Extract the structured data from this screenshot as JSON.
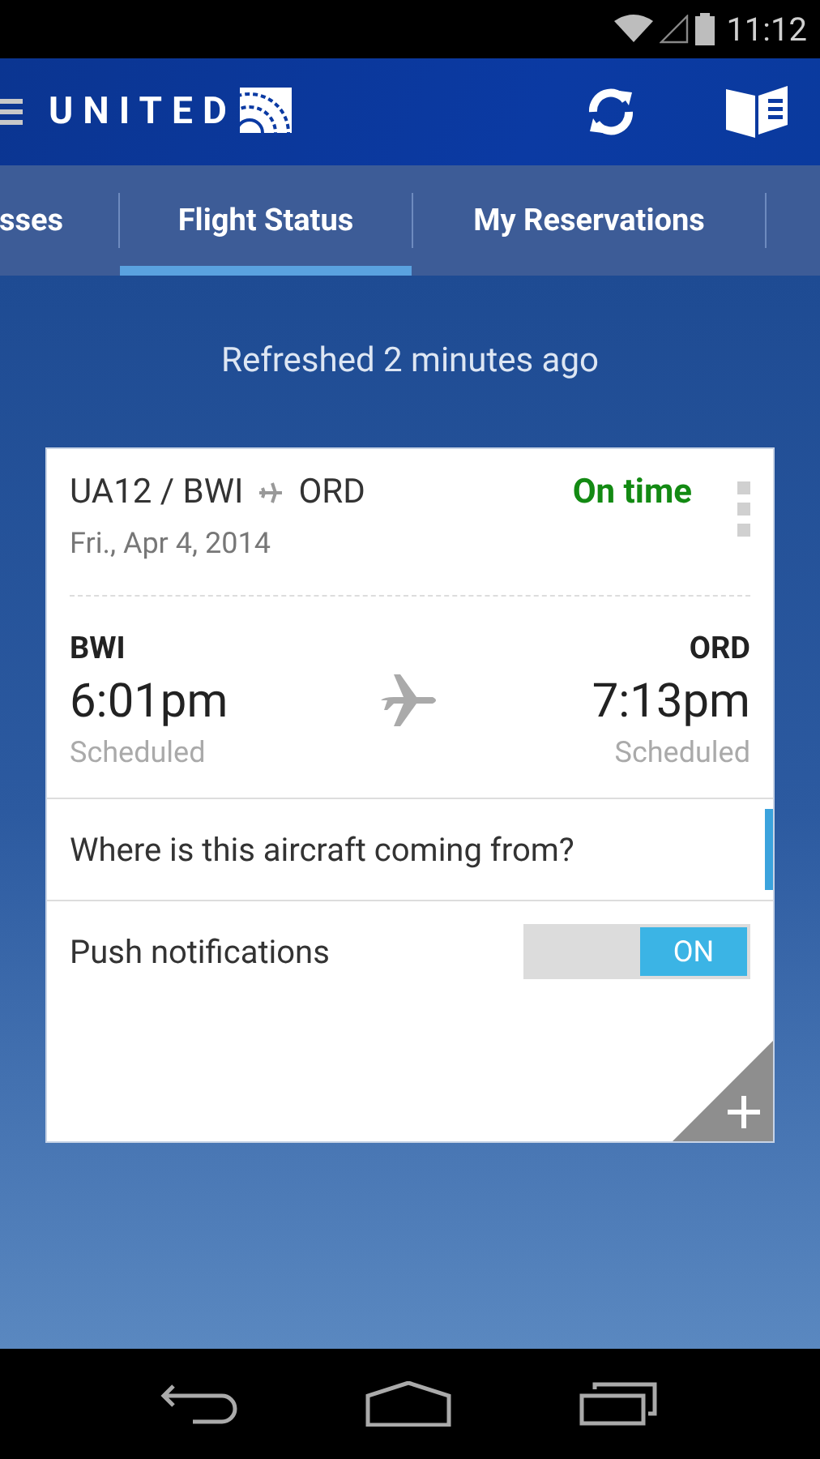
{
  "status_bar": {
    "time": "11:12"
  },
  "header": {
    "logo_text": "UNITED"
  },
  "tabs": [
    {
      "label": "sses",
      "selected": false
    },
    {
      "label": "Flight Status",
      "selected": true
    },
    {
      "label": "My Reservations",
      "selected": false
    }
  ],
  "refreshed": "Refreshed 2 minutes ago",
  "flight_card": {
    "flight": "UA12 / BWI",
    "destination": "ORD",
    "date": "Fri., Apr 4, 2014",
    "status": "On time",
    "departure": {
      "airport": "BWI",
      "time": "6:01pm",
      "note": "Scheduled"
    },
    "arrival": {
      "airport": "ORD",
      "time": "7:13pm",
      "note": "Scheduled"
    },
    "aircraft_link": "Where is this aircraft coming from?",
    "push": {
      "label": "Push notifications",
      "on": true,
      "state_label": "ON"
    }
  }
}
